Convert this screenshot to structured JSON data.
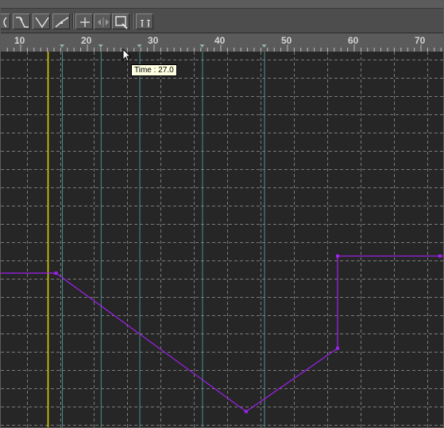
{
  "toolbar": {
    "buttons": [
      {
        "name": "tangent-smooth-icon"
      },
      {
        "name": "tangent-auto-icon"
      },
      {
        "name": "tangent-broken-icon"
      },
      {
        "name": "tangent-linear-icon"
      },
      {
        "name": "add-key-icon"
      },
      {
        "name": "move-horizontal-icon"
      },
      {
        "name": "zoom-region-icon"
      },
      {
        "name": "filter-icon"
      }
    ]
  },
  "ruler": {
    "labels": [
      "10",
      "20",
      "30",
      "40",
      "50",
      "60",
      "70"
    ]
  },
  "tooltip": {
    "text": "Time : 27.0"
  },
  "graph": {
    "curve_color": "#a020f0",
    "current_time_line_color": "#e6d600",
    "key_line_color": "#4a8f8f",
    "current_time": 15,
    "keys": [
      {
        "time": 15.3,
        "value": 0
      },
      {
        "time": 43.8,
        "value": -10.5
      },
      {
        "time": 57.5,
        "value": -5.7
      },
      {
        "time": 57.5,
        "value": 1.3
      }
    ],
    "key_marker_times": [
      16.2,
      22,
      27.8,
      37.2,
      46.5
    ]
  }
}
